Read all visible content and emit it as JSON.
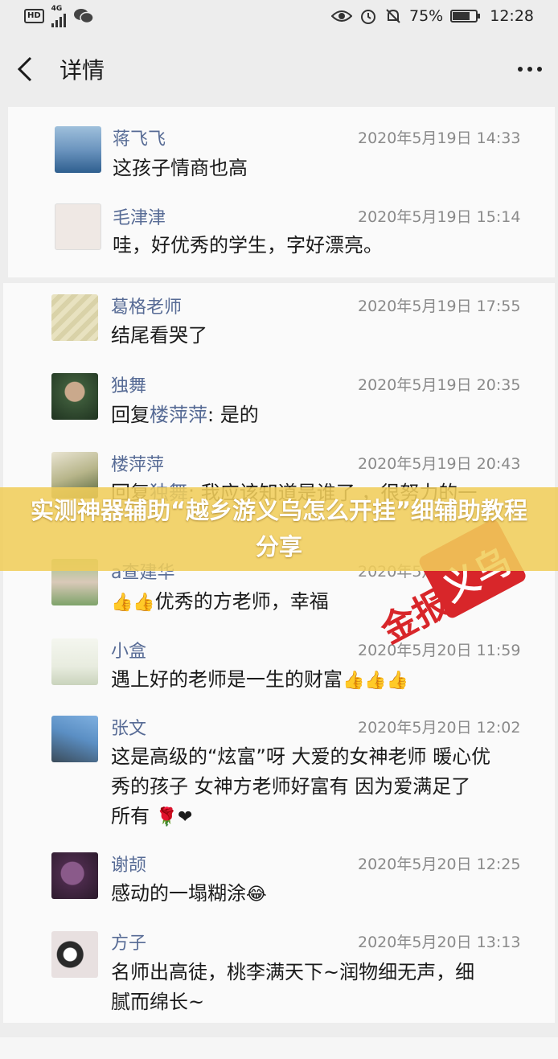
{
  "status_bar": {
    "hd": "HD",
    "network": "4G",
    "battery_percent": "75%",
    "battery_level": 0.75,
    "time": "12:28",
    "icons": [
      "hd-icon",
      "signal-icon",
      "wechat-icon",
      "eye-icon",
      "alarm-icon",
      "mute-icon",
      "battery-icon"
    ]
  },
  "nav": {
    "title": "详情",
    "back_icon": "chevron-left-icon",
    "more_icon": "more-dots-icon"
  },
  "comments_a": [
    {
      "name": "蒋飞飞",
      "time": "2020年5月19日 14:33",
      "text": "这孩子情商也高"
    },
    {
      "name": "毛津津",
      "time": "2020年5月19日 15:14",
      "text": "哇，好优秀的学生，字好漂亮。"
    }
  ],
  "comments_b": [
    {
      "name": "葛格老师",
      "time": "2020年5月19日 17:55",
      "text": "结尾看哭了"
    },
    {
      "name": "独舞",
      "time": "2020年5月19日 20:35",
      "reply_prefix": "回复",
      "mention": "楼萍萍",
      "text": ": 是的"
    },
    {
      "name": "楼萍萍",
      "time": "2020年5月19日 20:43",
      "reply_prefix": "回复",
      "mention": "独舞",
      "text": ": 我应该知道是谁了 ，很努力的一"
    },
    {
      "name": "a查建华",
      "time": "2020年5月19日",
      "text": "优秀的方老师，幸福",
      "emoji_prefix": "👍👍"
    },
    {
      "name": "小盒",
      "time": "2020年5月20日 11:59",
      "text": "遇上好的老师是一生的财富",
      "emoji_suffix": "👍👍👍"
    },
    {
      "name": "张文",
      "time": "2020年5月20日 12:02",
      "lines": [
        "这是高级的“炫富”呀 大爱的女神老师 暖心优",
        "秀的孩子 女神方老师好富有 因为爱满足了",
        "所有"
      ],
      "emoji_suffix": "🌹❤"
    },
    {
      "name": "谢颉",
      "time": "2020年5月20日 12:25",
      "text": "感动的一塌糊涂",
      "emoji_suffix": "😂"
    },
    {
      "name": "方子",
      "time": "2020年5月20日 13:13",
      "lines": [
        "名师出高徒，桃李满天下~润物细无声，细",
        "腻而绵长~"
      ]
    }
  ],
  "banner": {
    "text": "实测神器辅助“越乡游义乌怎么开挂”细辅助教程分享"
  },
  "stamp": {
    "chars_outline": "金报",
    "chars_box": "义乌"
  },
  "colors": {
    "background": "#ededed",
    "panel": "#fafafa",
    "name_link": "#576b95",
    "timestamp": "#8a8a8a",
    "banner": "#f0cd5a",
    "stamp_red": "#d8262a"
  }
}
